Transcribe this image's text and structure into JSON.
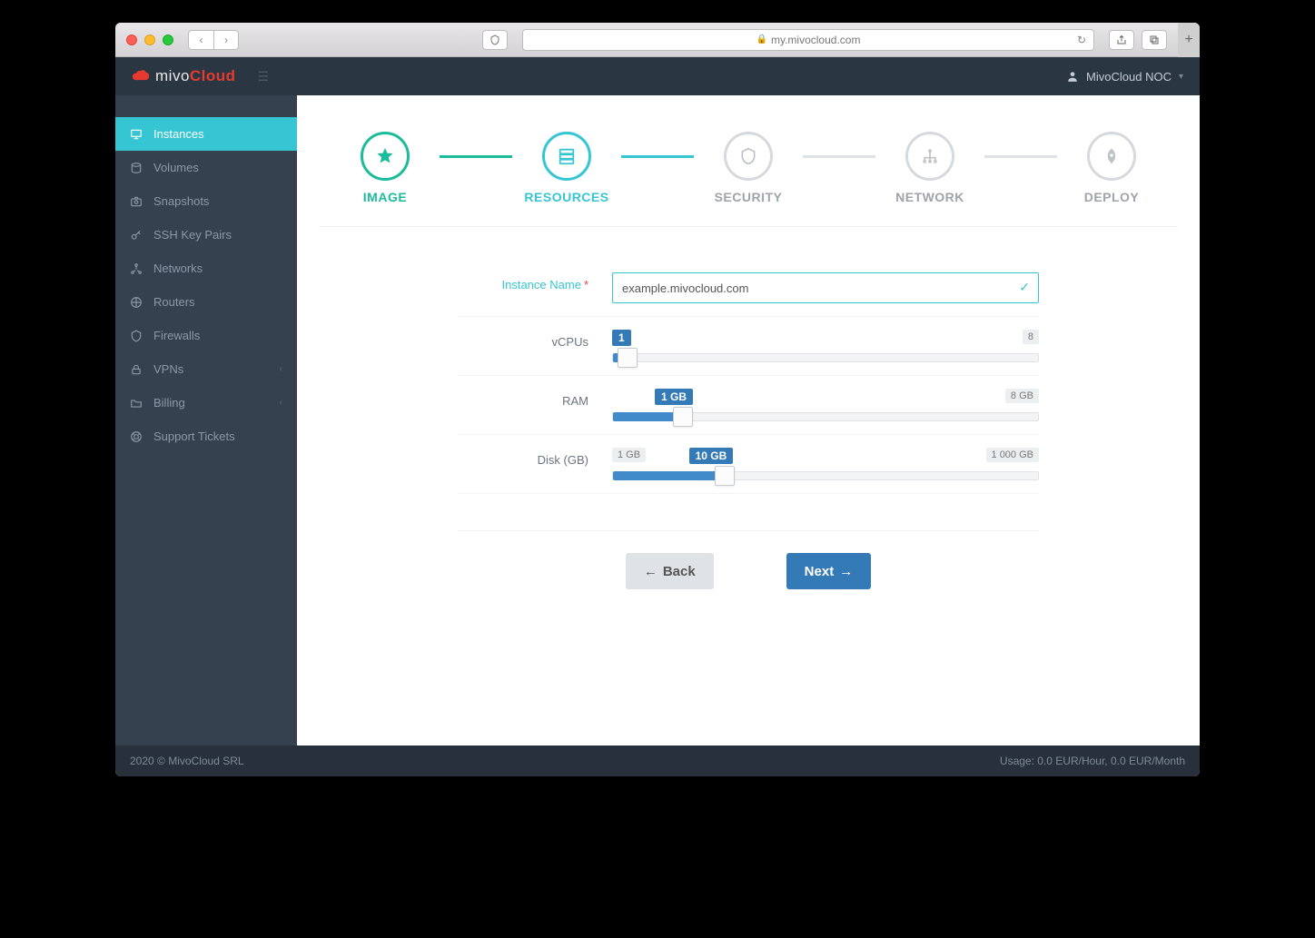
{
  "browser": {
    "url": "my.mivocloud.com"
  },
  "brand": {
    "part1": "mivo",
    "part2": "Cloud"
  },
  "user": {
    "name": "MivoCloud NOC"
  },
  "sidebar": {
    "items": [
      {
        "label": "Instances",
        "icon": "monitor"
      },
      {
        "label": "Volumes",
        "icon": "disk"
      },
      {
        "label": "Snapshots",
        "icon": "camera"
      },
      {
        "label": "SSH Key Pairs",
        "icon": "key"
      },
      {
        "label": "Networks",
        "icon": "network"
      },
      {
        "label": "Routers",
        "icon": "router"
      },
      {
        "label": "Firewalls",
        "icon": "shield"
      },
      {
        "label": "VPNs",
        "icon": "lock",
        "chev": true
      },
      {
        "label": "Billing",
        "icon": "folder",
        "chev": true
      },
      {
        "label": "Support Tickets",
        "icon": "lifebuoy"
      }
    ]
  },
  "stepper": {
    "steps": [
      {
        "label": "IMAGE",
        "state": "done"
      },
      {
        "label": "RESOURCES",
        "state": "active"
      },
      {
        "label": "SECURITY",
        "state": "todo"
      },
      {
        "label": "NETWORK",
        "state": "todo"
      },
      {
        "label": "DEPLOY",
        "state": "todo"
      }
    ]
  },
  "form": {
    "instance_name": {
      "label": "Instance Name",
      "value": "example.mivocloud.com"
    },
    "vcpus": {
      "label": "vCPUs",
      "value_label": "1",
      "max_label": "8",
      "fill_pct": 1,
      "thumb_pct": 1,
      "value_left_pct": 0
    },
    "ram": {
      "label": "RAM",
      "value_label": "1 GB",
      "max_label": "8 GB",
      "fill_pct": 14,
      "thumb_pct": 14,
      "value_left_pct": 10
    },
    "disk": {
      "label": "Disk (GB)",
      "min_label": "1 GB",
      "value_label": "10 GB",
      "max_label": "1 000 GB",
      "fill_pct": 24,
      "thumb_pct": 24,
      "value_left_pct": 18
    }
  },
  "actions": {
    "back": "Back",
    "next": "Next"
  },
  "footer": {
    "copyright": "2020 © MivoCloud SRL",
    "usage": "Usage: 0.0 EUR/Hour, 0.0 EUR/Month"
  }
}
